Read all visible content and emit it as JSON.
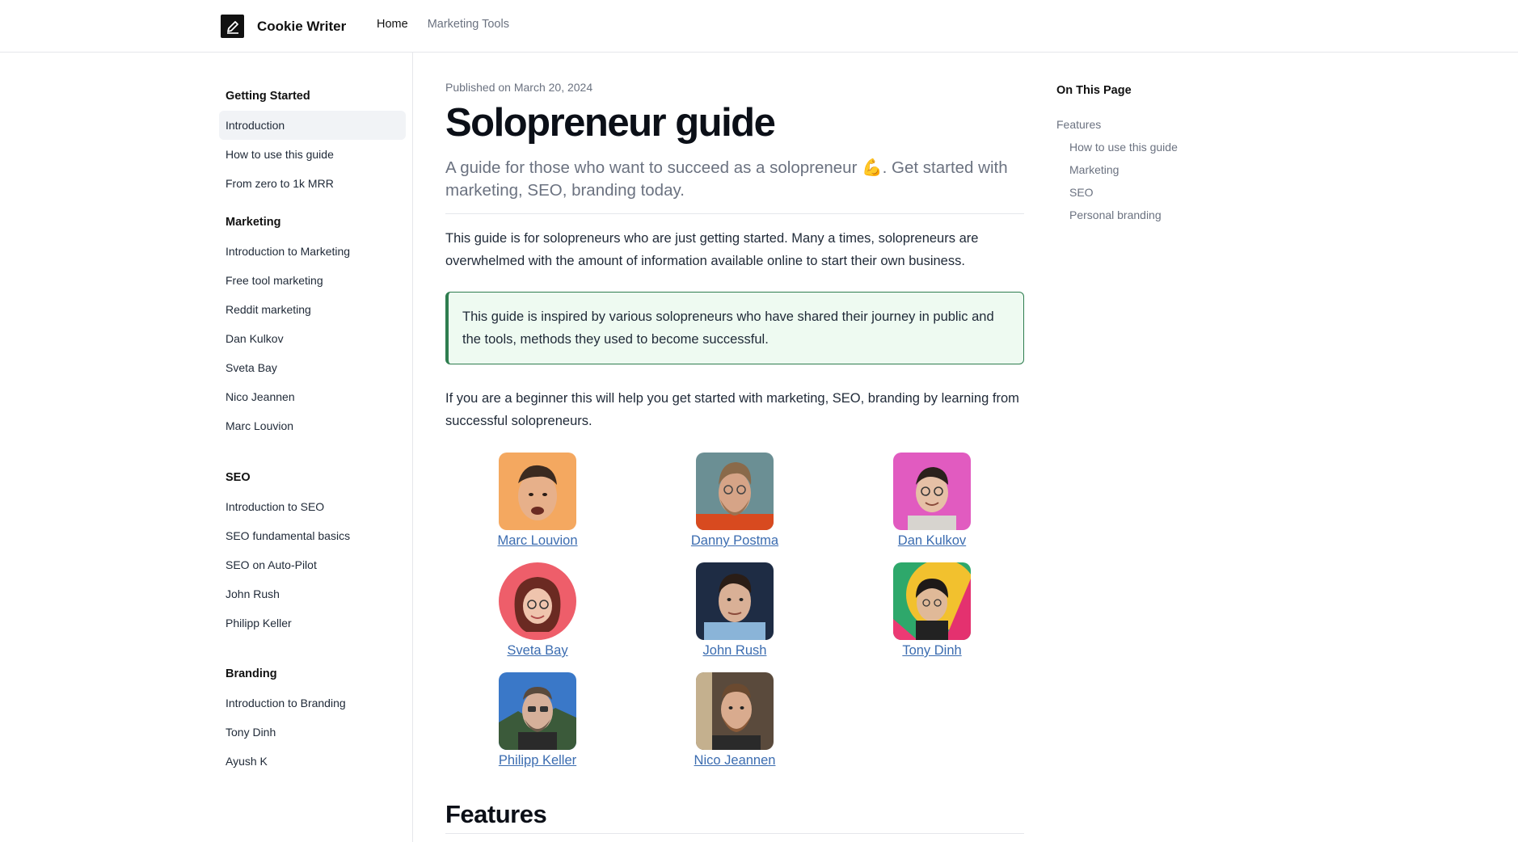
{
  "header": {
    "brand": "Cookie Writer",
    "nav": [
      {
        "label": "Home",
        "active": true
      },
      {
        "label": "Marketing Tools",
        "active": false
      }
    ]
  },
  "sidebar": {
    "groups": [
      {
        "heading": "Getting Started",
        "items": [
          "Introduction",
          "How to use this guide",
          "From zero to 1k MRR"
        ]
      },
      {
        "heading": "Marketing",
        "items": [
          "Introduction to Marketing",
          "Free tool marketing",
          "Reddit marketing",
          "Dan Kulkov",
          "Sveta Bay",
          "Nico Jeannen",
          "Marc Louvion"
        ]
      },
      {
        "heading": "SEO",
        "items": [
          "Introduction to SEO",
          "SEO fundamental basics",
          "SEO on Auto-Pilot",
          "John Rush",
          "Philipp Keller"
        ]
      },
      {
        "heading": "Branding",
        "items": [
          "Introduction to Branding",
          "Tony Dinh",
          "Ayush K"
        ]
      }
    ],
    "active_item": "Introduction"
  },
  "main": {
    "published": "Published on March 20, 2024",
    "title": "Solopreneur guide",
    "lead_before": "A guide for those who want to succeed as a solopreneur ",
    "lead_emoji": "💪",
    "lead_after": ". Get started with marketing, SEO, branding today.",
    "intro": "This guide is for solopreneurs who are just getting started. Many a times, solopreneurs are overwhelmed with the amount of information available online to start their own business.",
    "callout": "This guide is inspired by various solopreneurs who have shared their journey in public and the tools, methods they used to become successful.",
    "beginner": "If you are a beginner this will help you get started with marketing, SEO, branding by learning from successful solopreneurs.",
    "people": [
      "Marc Louvion",
      "Danny Postma",
      "Dan Kulkov",
      "Sveta Bay",
      "John Rush",
      "Tony Dinh",
      "Philipp Keller",
      "Nico Jeannen"
    ],
    "features_heading": "Features"
  },
  "toc": {
    "heading": "On This Page",
    "items": [
      "Features",
      "How to use this guide",
      "Marketing",
      "SEO",
      "Personal branding"
    ]
  },
  "colors": {
    "link": "#3b6cb0",
    "callout_border": "#2e7d4f",
    "callout_bg": "#eefaf1",
    "active_bg": "#f1f3f6"
  }
}
